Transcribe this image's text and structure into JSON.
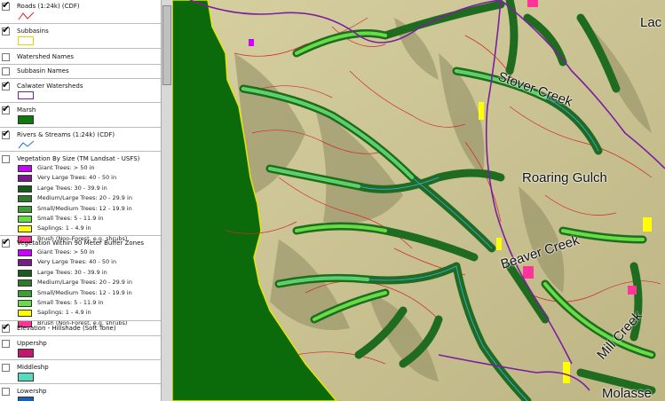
{
  "legend": {
    "layers": [
      {
        "label": "Roads (1:24k) (CDF)",
        "checked": true
      },
      {
        "label": "Subbasins",
        "checked": true
      },
      {
        "label": "Watershed Names",
        "checked": false
      },
      {
        "label": "Subbasin Names",
        "checked": false
      },
      {
        "label": "Calwater Watersheds",
        "checked": true
      },
      {
        "label": "Marsh",
        "checked": true
      },
      {
        "label": "Rivers & Streams (1:24k) (CDF)",
        "checked": true
      },
      {
        "label": "Vegetation By Size (TM Landsat - USFS)",
        "checked": false
      },
      {
        "label": "Vegetation Within 90 Meter Buffer Zones",
        "checked": true
      },
      {
        "label": "Elevation - Hillshade (Soft Tone)",
        "checked": true
      },
      {
        "label": "Uppershp",
        "checked": false
      },
      {
        "label": "Middleshp",
        "checked": false
      },
      {
        "label": "Lowershp",
        "checked": false
      }
    ],
    "veg_classes": [
      {
        "label": "Giant Trees: > 50 in",
        "color": "#cc00ff"
      },
      {
        "label": "Very Large Trees: 40 - 50 in",
        "color": "#7a1a8a"
      },
      {
        "label": "Large Trees: 30 - 39.9 in",
        "color": "#1a5a1a"
      },
      {
        "label": "Medium/Large Trees: 20 - 29.9 in",
        "color": "#2f7a2a"
      },
      {
        "label": "Small/Medium Trees: 12 - 19.9 in",
        "color": "#3e9e32"
      },
      {
        "label": "Small Trees: 5 - 11.9 in",
        "color": "#66dd44"
      },
      {
        "label": "Saplings: 1 - 4.9 in",
        "color": "#ffff00"
      },
      {
        "label": "Brush (Non-Forest, e.g. shrubs)",
        "color": "#ff3399"
      }
    ],
    "colors": {
      "roads": "#d12a2a",
      "subbasin": "#ffff00",
      "watershed": "#7b1fa2",
      "marsh": "#0d7a0d",
      "streams": "#2d6fd6",
      "upper": "#c0186e",
      "middle": "#55ddbb",
      "lower": "#1f5fb0"
    }
  },
  "map": {
    "labels": {
      "stover": "Stover Creek",
      "roaring": "Roaring Gulch",
      "beaver": "Beaver Creek",
      "mill": "Mill Creek",
      "molasses": "Molasse",
      "lac": "Lac"
    },
    "colors": {
      "terrain": "#c9c28f",
      "ocean": "#0b6b0b",
      "shadow": "#8c8a62"
    }
  }
}
